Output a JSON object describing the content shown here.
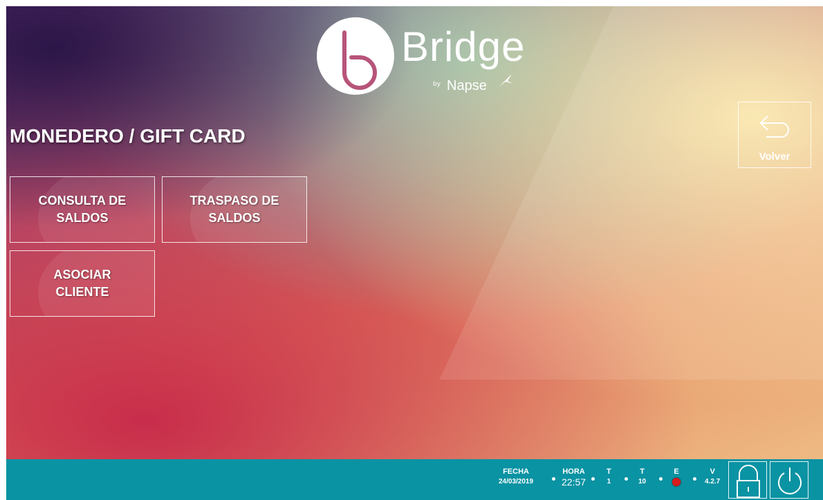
{
  "brand": {
    "name": "Bridge",
    "by": "by",
    "company": "Napse"
  },
  "page": {
    "title": "MONEDERO / GIFT CARD"
  },
  "menu": {
    "items": [
      {
        "label": "CONSULTA DE\nSALDOS"
      },
      {
        "label": "TRASPASO DE\nSALDOS"
      },
      {
        "label": "ASOCIAR\nCLIENTE"
      }
    ]
  },
  "nav": {
    "back_label": "Volver",
    "back_icon": "return-arrow-icon"
  },
  "status": {
    "fecha_label": "FECHA",
    "fecha_value": "24/03/2019",
    "hora_label": "HORA",
    "hora_value": "22:57",
    "t1_label": "T",
    "t1_value": "1",
    "t2_label": "T",
    "t2_value": "10",
    "e_label": "E",
    "e_color": "#d81b1b",
    "v_label": "V",
    "v_value": "4.2.7"
  },
  "footer_buttons": {
    "lock_icon": "lock-icon",
    "power_icon": "power-icon"
  },
  "colors": {
    "footer": "#0a93a3",
    "accent": "#ffffff"
  }
}
